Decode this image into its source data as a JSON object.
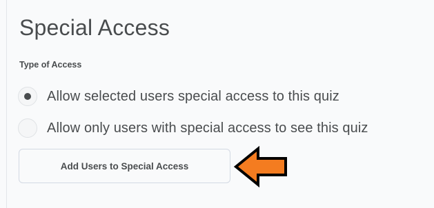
{
  "page": {
    "title": "Special Access",
    "type_of_access_label": "Type of Access"
  },
  "access_options": [
    {
      "label": "Allow selected users special access to this quiz",
      "selected": true
    },
    {
      "label": "Allow only users with special access to see this quiz",
      "selected": false
    }
  ],
  "add_button": {
    "label": "Add Users to Special Access"
  },
  "annotation": {
    "icon": "arrow-left-icon",
    "fill_color": "#f47c20",
    "stroke_color": "#000000"
  }
}
